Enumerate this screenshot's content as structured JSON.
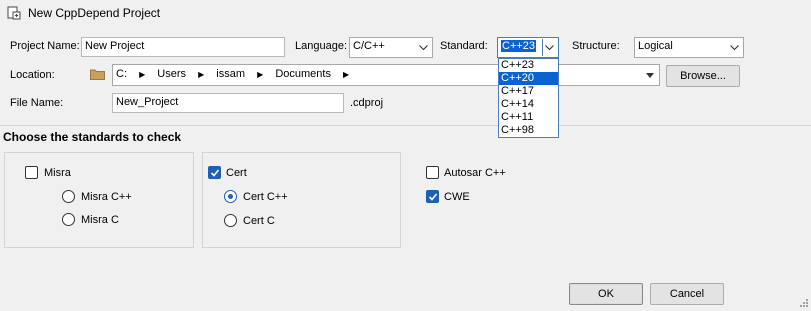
{
  "window": {
    "title": "New CppDepend Project"
  },
  "form": {
    "project_name_label": "Project Name:",
    "project_name_value": "New Project",
    "language_label": "Language:",
    "language_value": "C/C++",
    "standard_label": "Standard:",
    "standard_value": "C++23",
    "structure_label": "Structure:",
    "structure_value": "Logical",
    "location_label": "Location:",
    "location_crumbs": [
      "C:",
      "Users",
      "issam",
      "Documents"
    ],
    "browse_label": "Browse...",
    "file_name_label": "File Name:",
    "file_name_value": "New_Project",
    "file_ext": ".cdproj"
  },
  "standard_dropdown": {
    "options": [
      "C++23",
      "C++20",
      "C++17",
      "C++14",
      "C++11",
      "C++98"
    ],
    "highlighted": "C++20"
  },
  "standards": {
    "heading": "Choose the standards to check",
    "misra": {
      "label": "Misra",
      "checked": false,
      "options": [
        "Misra C++",
        "Misra C"
      ]
    },
    "cert": {
      "label": "Cert",
      "checked": true,
      "options": [
        "Cert C++",
        "Cert C"
      ],
      "selected": "Cert C++"
    },
    "autosar": {
      "label": "Autosar C++",
      "checked": false
    },
    "cwe": {
      "label": "CWE",
      "checked": true
    }
  },
  "buttons": {
    "ok": "OK",
    "cancel": "Cancel"
  },
  "colors": {
    "accent": "#1f5fb4",
    "selection": "#0a63d1"
  }
}
